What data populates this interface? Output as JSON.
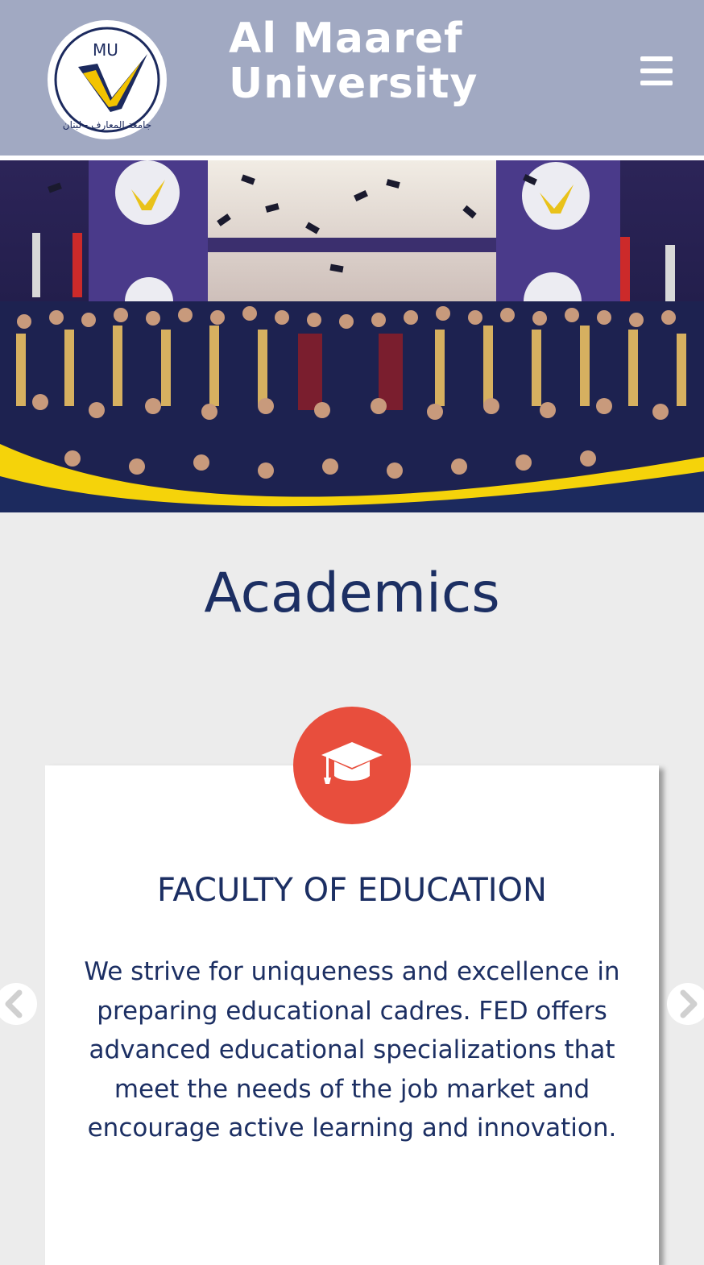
{
  "header": {
    "logo_text": "MU",
    "logo_arabic": "جامعة المعارف - لبنان",
    "brand_line1": "Al Maaref",
    "brand_line2": "University",
    "menu_icon": "hamburger-menu-icon"
  },
  "hero": {
    "image_subject": "graduation ceremony photo",
    "accent_colors": [
      "#f5d30a",
      "#1c2a5e"
    ]
  },
  "academics": {
    "title": "Academics",
    "card": {
      "icon": "graduation-cap-icon",
      "title": "FACULTY OF EDUCATION",
      "description": "We strive for uniqueness and excellence in preparing educational cadres. FED offers advanced educational specializations that meet the needs of the job market and encourage active learning and innovation."
    },
    "prev_icon": "chevron-left-icon",
    "next_icon": "chevron-right-icon"
  },
  "colors": {
    "header_bg": "#a1a9c2",
    "navy": "#1c2f63",
    "icon_red": "#e84e3d",
    "page_bg": "#ececec"
  }
}
